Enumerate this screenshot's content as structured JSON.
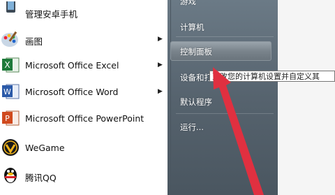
{
  "left_menu": [
    {
      "label": "管理安卓手机",
      "icon": "android-phone-icon",
      "has_arrow": false
    },
    {
      "label": "画图",
      "icon": "paint-icon",
      "has_arrow": true
    },
    {
      "label": "Microsoft Office Excel",
      "icon": "excel-icon",
      "has_arrow": true
    },
    {
      "label": "Microsoft Office Word",
      "icon": "word-icon",
      "has_arrow": true
    },
    {
      "label": "Microsoft Office PowerPoint",
      "icon": "powerpoint-icon",
      "has_arrow": false
    },
    {
      "label": "WeGame",
      "icon": "wegame-icon",
      "has_arrow": false
    },
    {
      "label": "腾讯QQ",
      "icon": "qq-penguin-icon",
      "has_arrow": false
    }
  ],
  "arrow_glyph": "▶",
  "right_menu": [
    {
      "label": "游戏"
    },
    {
      "label": "计算机"
    },
    {
      "label": "控制面板"
    },
    {
      "label": "设备和打"
    },
    {
      "label": "默认程序"
    },
    {
      "label": "运行..."
    }
  ],
  "tooltip": "更改您的计算机设置并自定义其",
  "colors": {
    "right_panel": "#5e6b76",
    "annotation_arrow": "#e03040",
    "highlight": "#8a949c"
  }
}
